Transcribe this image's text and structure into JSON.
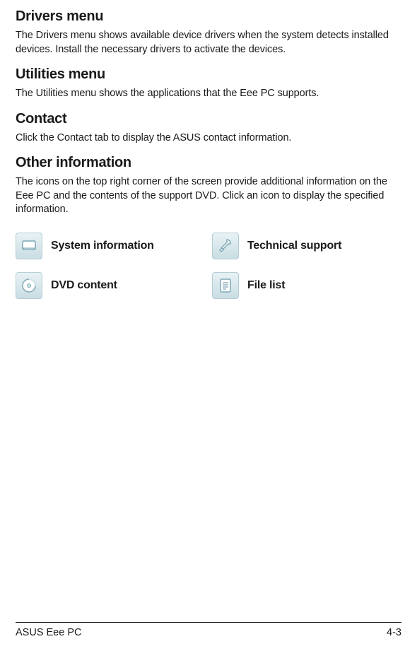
{
  "sections": [
    {
      "heading": "Drivers menu",
      "body": "The Drivers menu shows available device drivers when the system detects installed devices. Install the necessary drivers to activate the devices."
    },
    {
      "heading": "Utilities menu",
      "body": "The Utilities menu shows the applications that the Eee PC supports."
    },
    {
      "heading": "Contact",
      "body": "Click the Contact tab to display the ASUS contact information."
    },
    {
      "heading": "Other information",
      "body": "The icons on the top right corner of the screen provide additional information on the Eee PC and the contents of the support DVD. Click an icon to display the specified information."
    }
  ],
  "icons": {
    "system_info": "System information",
    "tech_support": "Technical support",
    "dvd_content": "DVD content",
    "file_list": "File list"
  },
  "footer": {
    "left": "ASUS Eee PC",
    "right": "4-3"
  }
}
